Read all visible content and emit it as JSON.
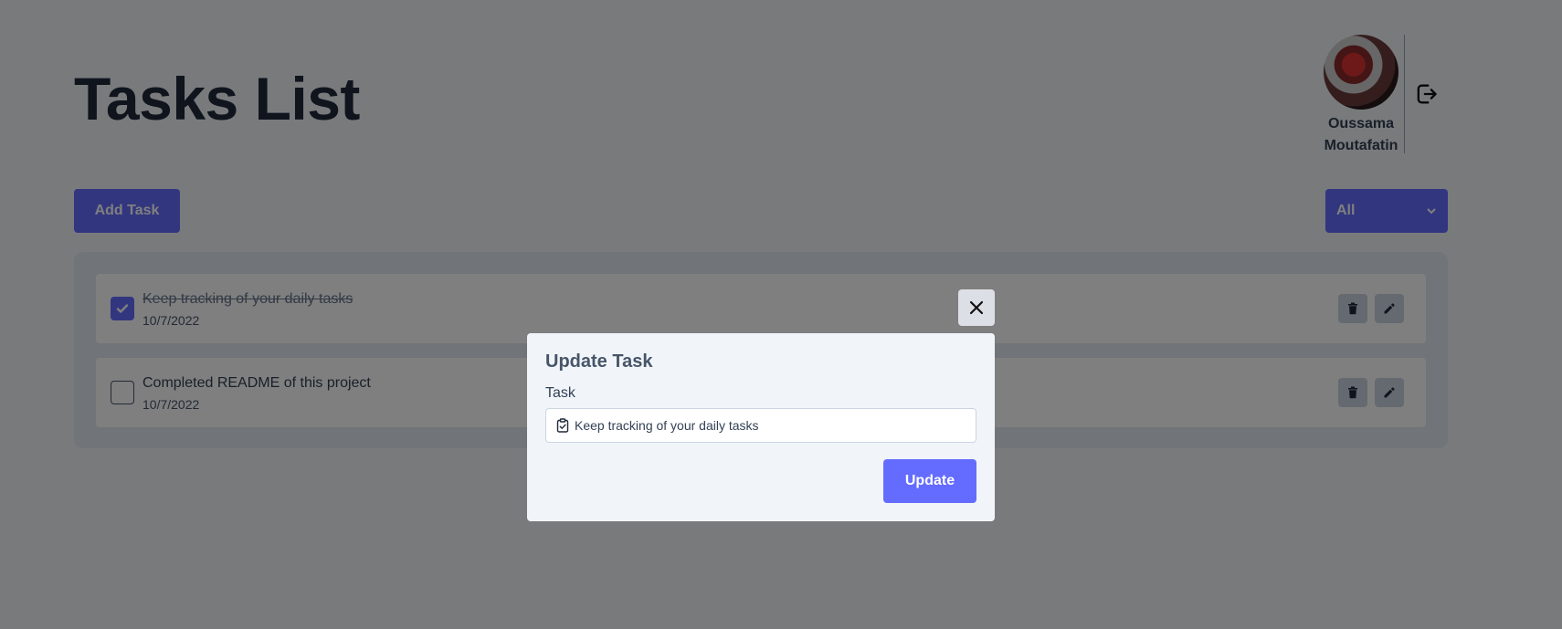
{
  "page": {
    "title": "Tasks List"
  },
  "user": {
    "first_name": "Oussama",
    "last_name": "Moutafatin"
  },
  "toolbar": {
    "add_label": "Add Task",
    "filter_value": "All"
  },
  "tasks": [
    {
      "text": "Keep tracking of your daily tasks",
      "date": "10/7/2022",
      "completed": true
    },
    {
      "text": "Completed README of this project",
      "date": "10/7/2022",
      "completed": false
    }
  ],
  "modal": {
    "title": "Update Task",
    "field_label": "Task",
    "field_value": "Keep tracking of your daily tasks",
    "submit_label": "Update"
  },
  "colors": {
    "accent": "#646cff",
    "background": "#f1f5f9",
    "overlay": "rgba(0,0,0,0.5)"
  },
  "icons": {
    "logout": "logout-icon",
    "check": "check-icon",
    "trash": "trash-icon",
    "edit": "pencil-icon",
    "close": "close-icon",
    "task_field": "clipboard-check-icon",
    "filter_caret": "chevron-down-icon"
  }
}
